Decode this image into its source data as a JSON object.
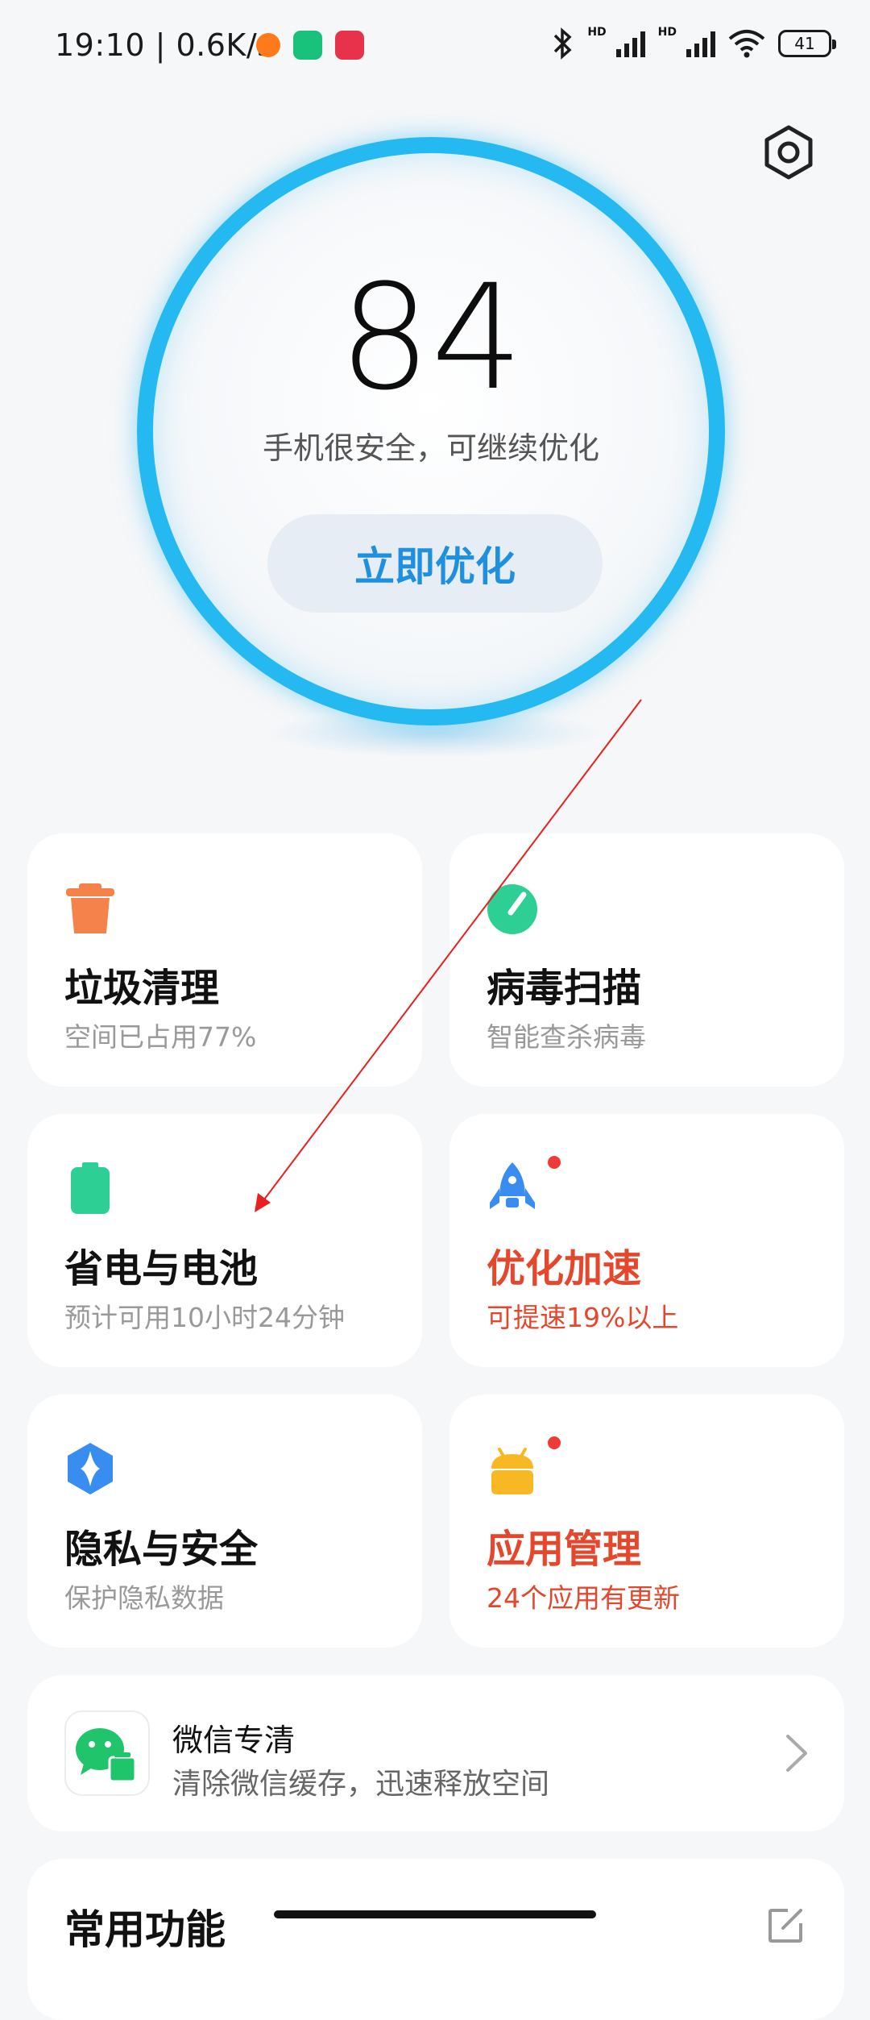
{
  "status_bar": {
    "time": "19:10 | 0.6K/s",
    "battery": "41",
    "hd": "HD"
  },
  "score": {
    "value": "84",
    "description": "手机很安全，可继续优化",
    "button_label": "立即优化"
  },
  "cards": [
    {
      "title": "垃圾清理",
      "subtitle": "空间已占用77%"
    },
    {
      "title": "病毒扫描",
      "subtitle": "智能查杀病毒"
    },
    {
      "title": "省电与电池",
      "subtitle": "预计可用10小时24分钟"
    },
    {
      "title": "优化加速",
      "subtitle": "可提速19%以上"
    },
    {
      "title": "隐私与安全",
      "subtitle": "保护隐私数据"
    },
    {
      "title": "应用管理",
      "subtitle": "24个应用有更新"
    }
  ],
  "wechat": {
    "title": "微信专清",
    "subtitle": "清除微信缓存，迅速释放空间"
  },
  "common": {
    "title": "常用功能"
  },
  "colors": {
    "ring": "#25b9f2",
    "accent_blue": "#1f90e0",
    "warning": "#e5472c",
    "trash": "#f5824a",
    "green": "#2ecf94",
    "rocket": "#3a8df0",
    "android": "#f7b823"
  },
  "icons": [
    "settings-icon",
    "trash-icon",
    "virus-scan-icon",
    "battery-icon",
    "rocket-icon",
    "shield-icon",
    "android-icon",
    "wechat-icon",
    "chevron-right-icon",
    "edit-icon"
  ]
}
